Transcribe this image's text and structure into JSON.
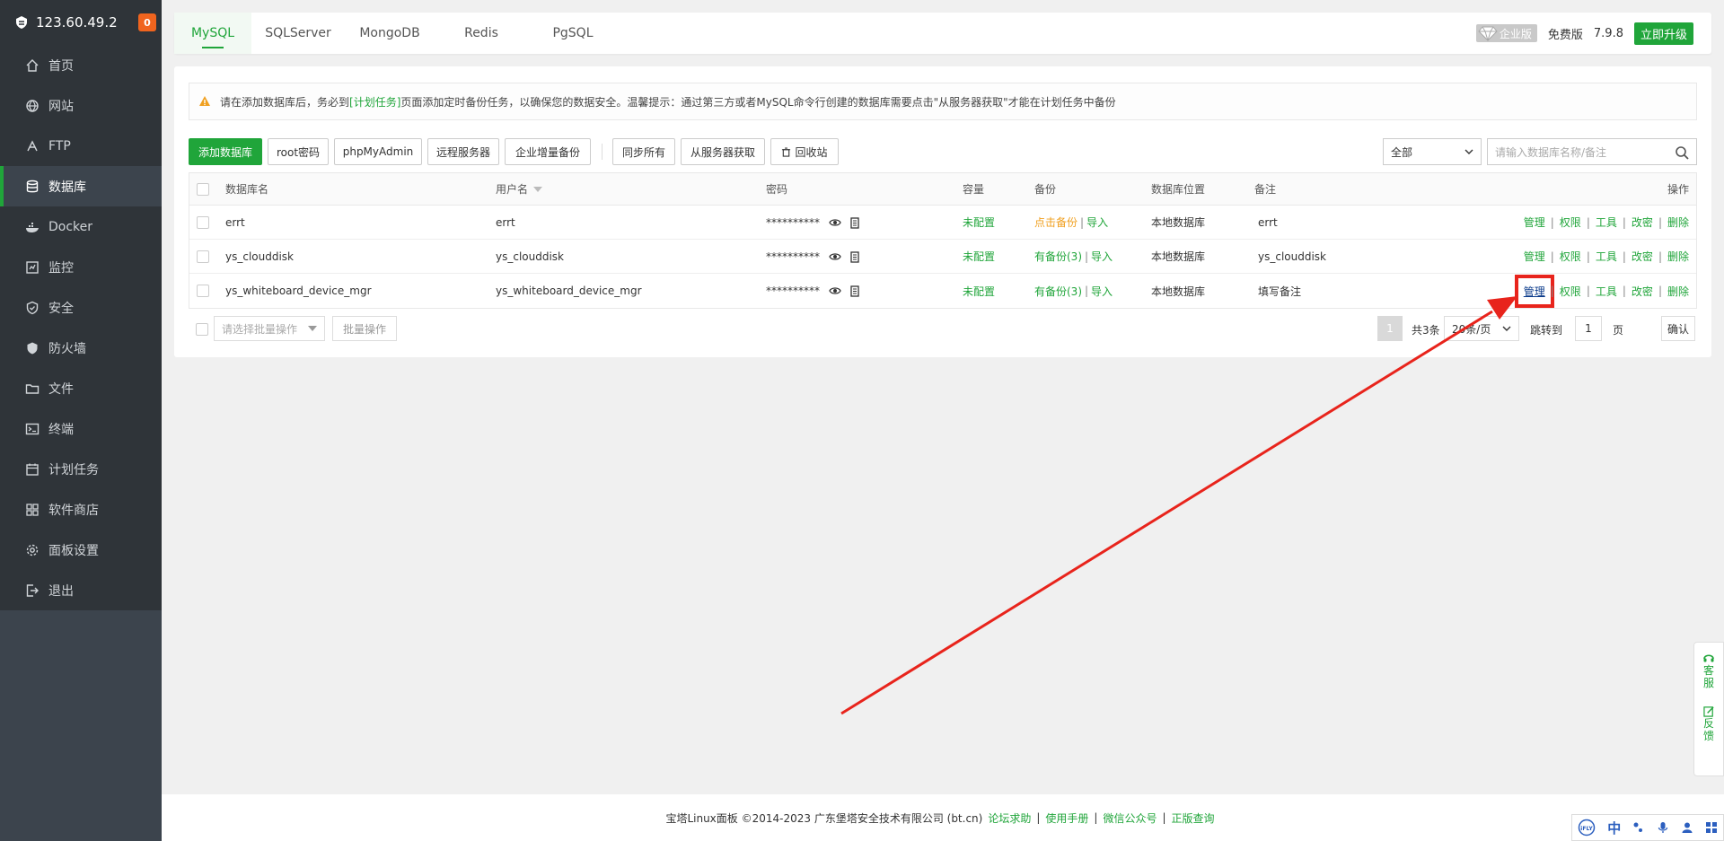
{
  "sidebar": {
    "ip": "123.60.49.2",
    "badge": "0",
    "items": [
      {
        "label": "首页",
        "icon": "home-icon"
      },
      {
        "label": "网站",
        "icon": "globe-icon"
      },
      {
        "label": "FTP",
        "icon": "ftp-icon"
      },
      {
        "label": "数据库",
        "icon": "database-icon",
        "active": true
      },
      {
        "label": "Docker",
        "icon": "docker-icon"
      },
      {
        "label": "监控",
        "icon": "monitor-icon"
      },
      {
        "label": "安全",
        "icon": "shield-icon"
      },
      {
        "label": "防火墙",
        "icon": "firewall-icon"
      },
      {
        "label": "文件",
        "icon": "folder-icon"
      },
      {
        "label": "终端",
        "icon": "terminal-icon"
      },
      {
        "label": "计划任务",
        "icon": "calendar-icon"
      },
      {
        "label": "软件商店",
        "icon": "grid-icon"
      },
      {
        "label": "面板设置",
        "icon": "gear-icon"
      },
      {
        "label": "退出",
        "icon": "logout-icon"
      }
    ]
  },
  "tabs": [
    "MySQL",
    "SQLServer",
    "MongoDB",
    "Redis",
    "PgSQL"
  ],
  "topright": {
    "enterprise": "企业版",
    "free": "免费版",
    "version": "7.9.8",
    "upgrade": "立即升级"
  },
  "notice": {
    "prefix": "请在添加数据库后，务必到",
    "link": "[计划任务]",
    "suffix": "页面添加定时备份任务，以确保您的数据安全。温馨提示：通过第三方或者MySQL命令行创建的数据库需要点击\"从服务器获取\"才能在计划任务中备份"
  },
  "toolbar": {
    "add": "添加数据库",
    "root": "root密码",
    "pma": "phpMyAdmin",
    "remote": "远程服务器",
    "incremental": "企业增量备份",
    "sync": "同步所有",
    "fetch": "从服务器获取",
    "recycle": "回收站",
    "filter": "全部",
    "search_placeholder": "请输入数据库名称/备注"
  },
  "table": {
    "headers": {
      "name": "数据库名",
      "user": "用户名",
      "password": "密码",
      "capacity": "容量",
      "backup": "备份",
      "location": "数据库位置",
      "remark": "备注",
      "ops": "操作"
    },
    "rows": [
      {
        "name": "errt",
        "user": "errt",
        "password": "**********",
        "capacity": "未配置",
        "backup": "点击备份",
        "import": "导入",
        "location": "本地数据库",
        "remark": "errt"
      },
      {
        "name": "ys_clouddisk",
        "user": "ys_clouddisk",
        "password": "**********",
        "capacity": "未配置",
        "backup": "有备份(3)",
        "import": "导入",
        "location": "本地数据库",
        "remark": "ys_clouddisk"
      },
      {
        "name": "ys_whiteboard_device_mgr",
        "user": "ys_whiteboard_device_mgr",
        "password": "**********",
        "capacity": "未配置",
        "backup": "有备份(3)",
        "import": "导入",
        "location": "本地数据库",
        "remark": "填写备注"
      }
    ],
    "ops": [
      "管理",
      "权限",
      "工具",
      "改密",
      "删除"
    ]
  },
  "pager": {
    "batch_placeholder": "请选择批量操作",
    "batch_btn": "批量操作",
    "page": "1",
    "total": "共3条",
    "per_page": "20条/页",
    "jump": "跳转到",
    "jump_value": "1",
    "page_unit": "页",
    "confirm": "确认"
  },
  "footer": {
    "copyright": "宝塔Linux面板 ©2014-2023 广东堡塔安全技术有限公司 (bt.cn)",
    "links": [
      "论坛求助",
      "使用手册",
      "微信公众号",
      "正版查询"
    ]
  },
  "float": {
    "service": [
      "客",
      "服"
    ],
    "feedback": [
      "反",
      "馈"
    ]
  },
  "ime": {
    "lang": "中"
  },
  "colors": {
    "accent": "#20a53a",
    "highlight": "#e8241c"
  }
}
